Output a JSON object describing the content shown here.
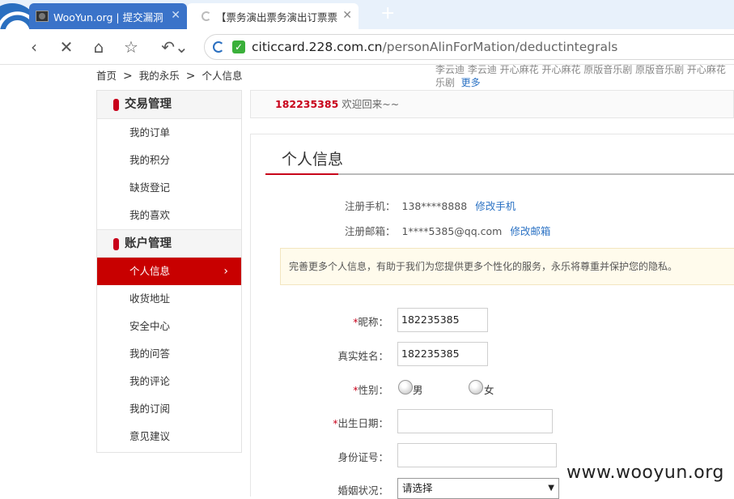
{
  "browser": {
    "tabs": [
      {
        "title": "WooYun.org | 提交漏洞"
      },
      {
        "title": "【票务演出票务演出订票票"
      }
    ],
    "url": {
      "domain": "citiccard.228.com.cn",
      "path": "/personAlinForMation/deductintegrals"
    }
  },
  "breadcrumb": {
    "items": [
      "首页",
      "我的永乐",
      "个人信息"
    ],
    "separator": ">"
  },
  "top_links": {
    "line1": "李云迪  李云迪  开心麻花  开心麻花  原版音乐剧  原版音乐剧  开心麻花",
    "line2": "乐剧",
    "more": "更多"
  },
  "sidebar": {
    "sections": [
      {
        "title": "交易管理",
        "items": [
          "我的订单",
          "我的积分",
          "缺货登记",
          "我的喜欢"
        ]
      },
      {
        "title": "账户管理",
        "items": [
          "个人信息",
          "收货地址",
          "安全中心",
          "我的问答",
          "我的评论",
          "我的订阅",
          "意见建议"
        ]
      }
    ],
    "active": "个人信息"
  },
  "welcome": {
    "user_id": "182235385",
    "greeting": "欢迎回来~~"
  },
  "main": {
    "title": "个人信息",
    "phone": {
      "label": "注册手机：",
      "value": "138****8888",
      "link": "修改手机"
    },
    "email": {
      "label": "注册邮箱：",
      "value": "1****5385@qq.com",
      "link": "修改邮箱"
    },
    "notice": "完善更多个人信息，有助于我们为您提供更多个性化的服务，永乐将尊重并保护您的隐私。",
    "form": {
      "nickname": {
        "req": "*",
        "label": "昵称：",
        "value": "182235385"
      },
      "realname": {
        "label": "真实姓名：",
        "value": "182235385"
      },
      "gender": {
        "req": "*",
        "label": "性别：",
        "options": [
          "男",
          "女"
        ]
      },
      "birthday": {
        "req": "*",
        "label": "出生日期：",
        "value": ""
      },
      "idcard": {
        "label": "身份证号：",
        "value": ""
      },
      "marriage": {
        "label": "婚姻状况：",
        "value": "请选择"
      }
    }
  },
  "watermark": "www.wooyun.org"
}
